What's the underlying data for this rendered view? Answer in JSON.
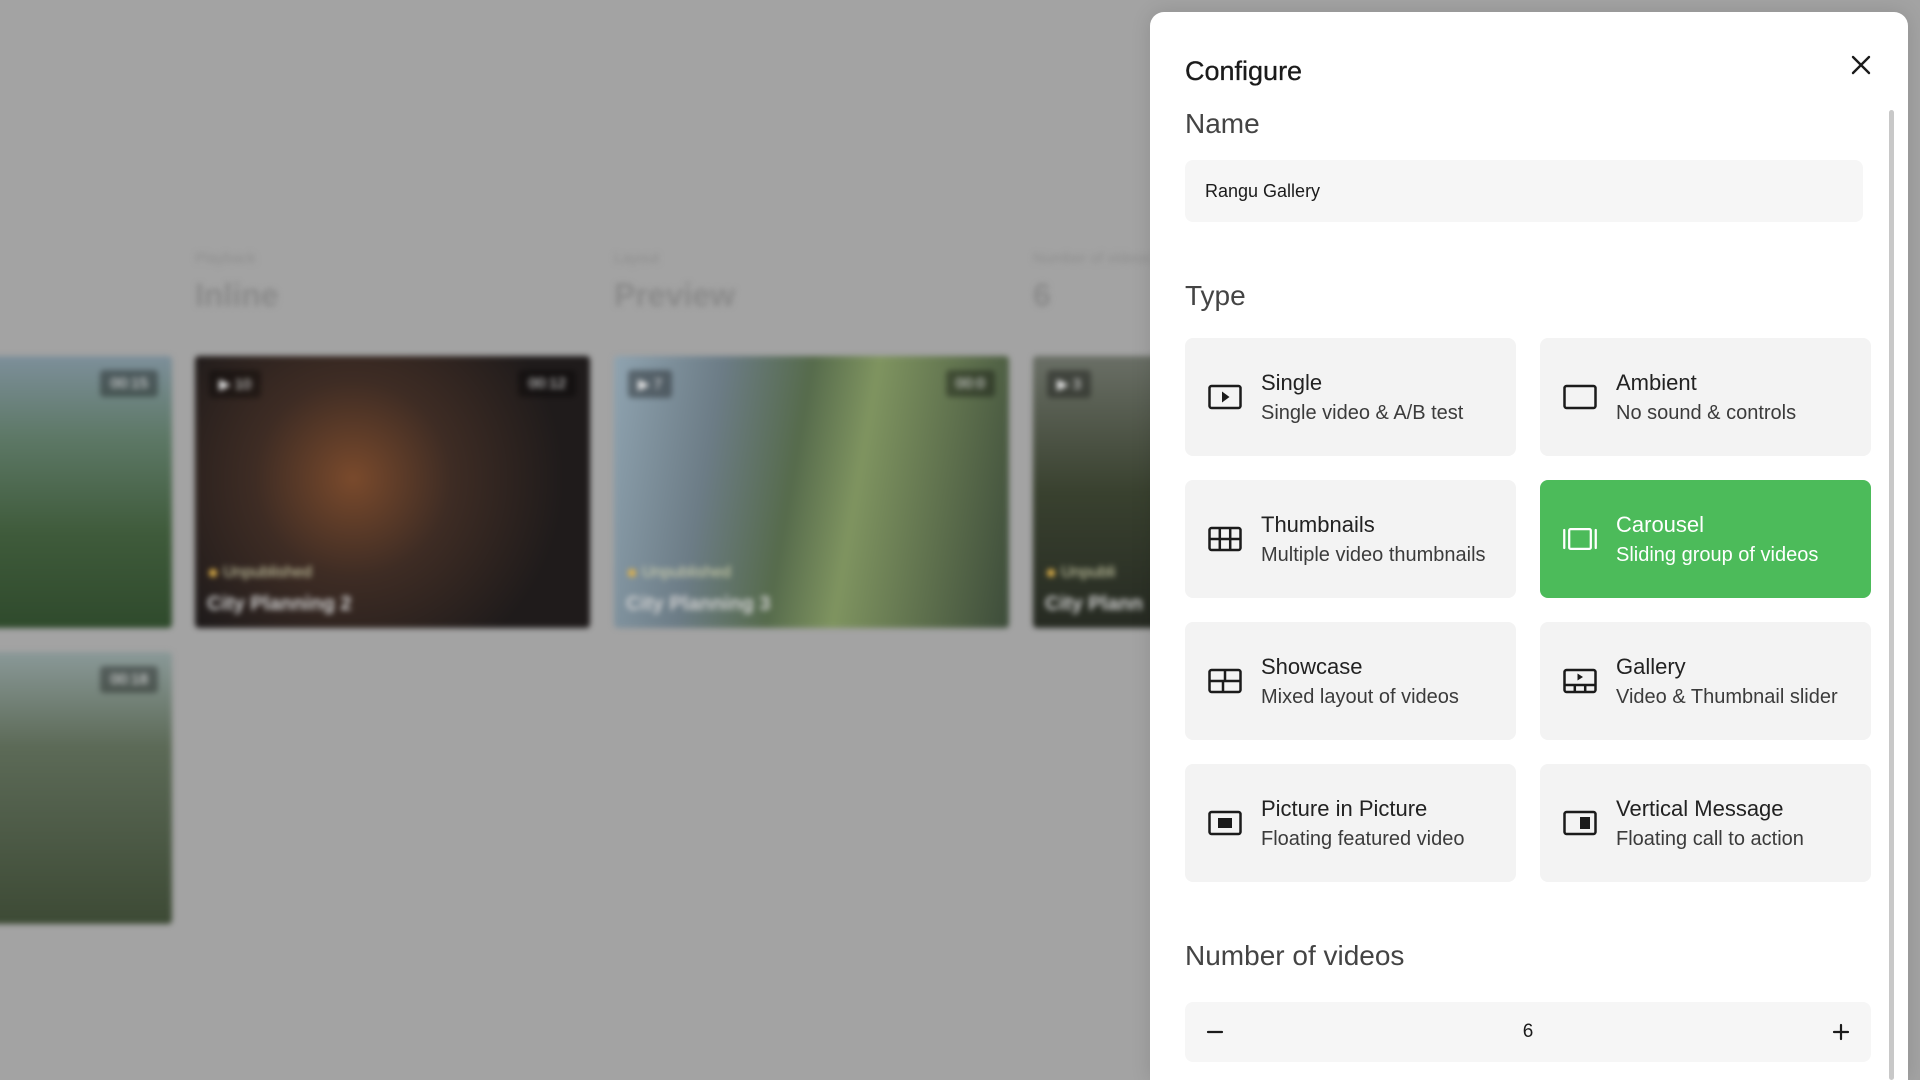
{
  "background": {
    "stats": [
      {
        "label": "Playback",
        "value": "Inline"
      },
      {
        "label": "Layout",
        "value": "Preview"
      },
      {
        "label": "Number of videos",
        "value": "6"
      }
    ],
    "videos": [
      {
        "title": "",
        "status": "",
        "duration": "00:15",
        "views": ""
      },
      {
        "title": "City Planning 2",
        "status": "Unpublished",
        "duration": "00:12",
        "views": "10"
      },
      {
        "title": "City Planning 3",
        "status": "Unpublished",
        "duration": "00:0",
        "views": "7"
      },
      {
        "title": "City Plann",
        "status": "Unpubli",
        "duration": "",
        "views": "3"
      },
      {
        "title": "",
        "status": "",
        "duration": "00:18",
        "views": ""
      }
    ]
  },
  "panel": {
    "title": "Configure",
    "name_label": "Name",
    "name_value": "Rangu Gallery",
    "type_label": "Type",
    "types": [
      {
        "name": "Single",
        "desc": "Single video & A/B test",
        "icon": "play-box-icon",
        "selected": false
      },
      {
        "name": "Ambient",
        "desc": "No sound & controls",
        "icon": "rectangle-icon",
        "selected": false
      },
      {
        "name": "Thumbnails",
        "desc": "Multiple video thumbnails",
        "icon": "grid-icon",
        "selected": false
      },
      {
        "name": "Carousel",
        "desc": "Sliding group of videos",
        "icon": "carousel-icon",
        "selected": true
      },
      {
        "name": "Showcase",
        "desc": "Mixed layout of videos",
        "icon": "showcase-icon",
        "selected": false
      },
      {
        "name": "Gallery",
        "desc": "Video & Thumbnail slider",
        "icon": "gallery-icon",
        "selected": false
      },
      {
        "name": "Picture in Picture",
        "desc": "Floating featured video",
        "icon": "pip-icon",
        "selected": false
      },
      {
        "name": "Vertical Message",
        "desc": "Floating call to action",
        "icon": "vertical-message-icon",
        "selected": false
      }
    ],
    "count_label": "Number of videos",
    "count_value": "6"
  },
  "colors": {
    "accent": "#4cbb5a",
    "overlay": "#a3a3a3"
  }
}
